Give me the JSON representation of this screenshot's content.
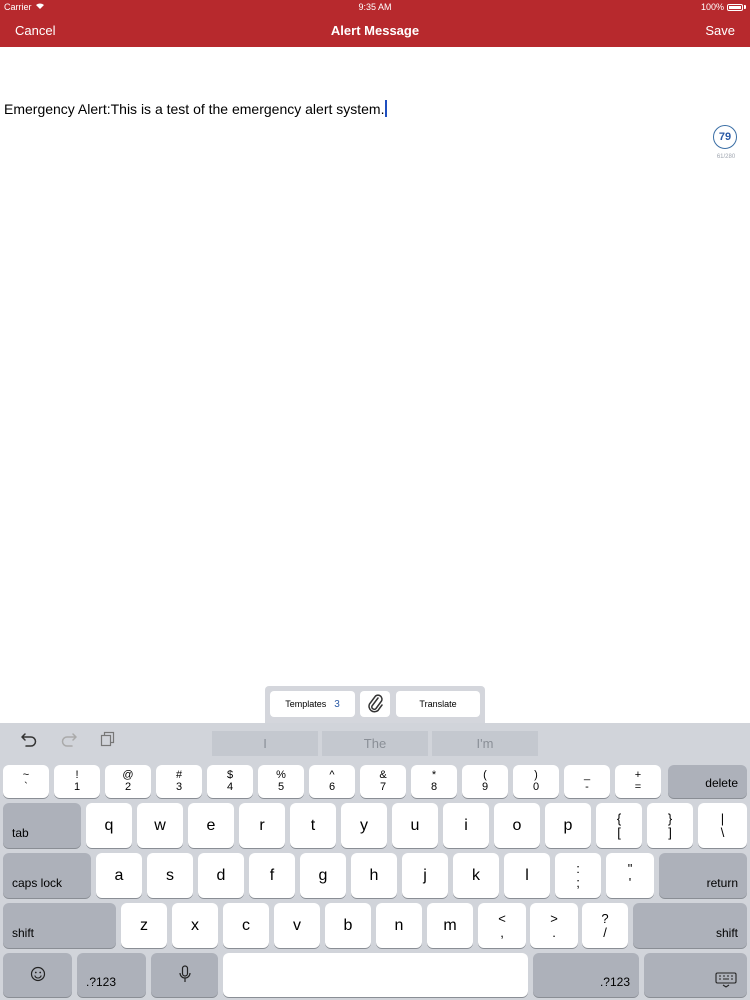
{
  "status_bar": {
    "carrier": "Carrier",
    "time": "9:35 AM",
    "battery": "100%"
  },
  "nav": {
    "cancel": "Cancel",
    "title": "Alert Message",
    "save": "Save"
  },
  "message": {
    "text": "Emergency Alert:This is a test of the emergency alert system."
  },
  "counter": {
    "remaining": "79",
    "usage": "61/280"
  },
  "accessory": {
    "templates_label": "Templates",
    "templates_count": "3",
    "translate_label": "Translate"
  },
  "keyboard": {
    "suggestions": [
      "I",
      "The",
      "I'm"
    ],
    "row1": [
      [
        "~",
        "`"
      ],
      [
        "!",
        "1"
      ],
      [
        "@",
        "2"
      ],
      [
        "#",
        "3"
      ],
      [
        "$",
        "4"
      ],
      [
        "%",
        "5"
      ],
      [
        "^",
        "6"
      ],
      [
        "&",
        "7"
      ],
      [
        "*",
        "8"
      ],
      [
        "(",
        "9"
      ],
      [
        ")",
        "0"
      ],
      [
        "_",
        "-"
      ],
      [
        "+",
        "="
      ]
    ],
    "delete": "delete",
    "tab": "tab",
    "row2": [
      "q",
      "w",
      "e",
      "r",
      "t",
      "y",
      "u",
      "i",
      "o",
      "p"
    ],
    "row2_extra": [
      [
        "{",
        "["
      ],
      [
        "}",
        "]"
      ],
      [
        "|",
        "\\"
      ]
    ],
    "caps": "caps lock",
    "row3": [
      "a",
      "s",
      "d",
      "f",
      "g",
      "h",
      "j",
      "k",
      "l"
    ],
    "row3_extra": [
      [
        ":",
        ";"
      ],
      [
        "\"",
        "'"
      ]
    ],
    "return": "return",
    "shift": "shift",
    "row4": [
      "z",
      "x",
      "c",
      "v",
      "b",
      "n",
      "m"
    ],
    "row4_extra": [
      [
        "<",
        ","
      ],
      [
        ">",
        "."
      ],
      [
        "?",
        "/"
      ]
    ],
    "numbers": ".?123"
  }
}
